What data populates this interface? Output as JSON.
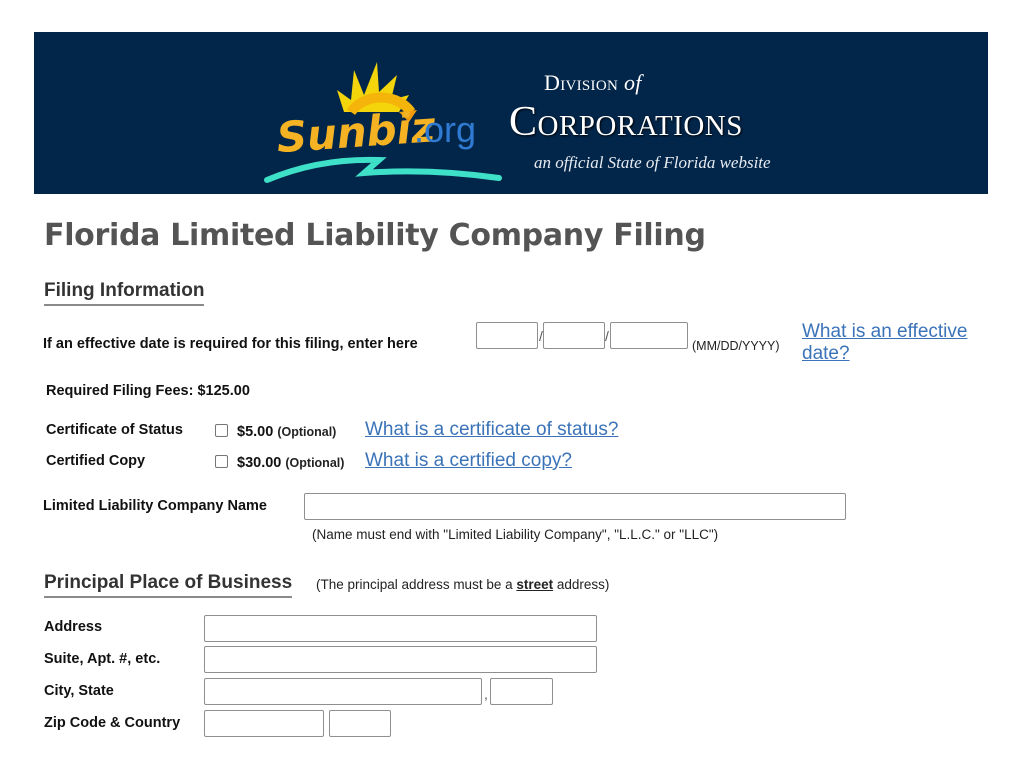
{
  "header": {
    "logo_text": "Sunbiz",
    "logo_domain": ".org",
    "division_prefix": "Division",
    "division_of": "of",
    "division_name": "Corporations",
    "tagline": "an official State of Florida website",
    "background_color": "#02264a"
  },
  "page_title": "Florida Limited Liability Company Filing",
  "filing_information": {
    "section_title": "Filing Information",
    "effective_date": {
      "label": "If an effective date is required for this filing, enter here",
      "month_value": "",
      "day_value": "",
      "year_value": "",
      "separator": "/",
      "format_hint": "(MM/DD/YYYY)",
      "help_link": "What is an effective date?"
    },
    "required_fees_label": "Required Filing Fees: $125.00",
    "options": [
      {
        "label": "Certificate of Status",
        "checked": false,
        "price": "$5.00",
        "optional_tag": "(Optional)",
        "help_link": "What is a certificate of status?"
      },
      {
        "label": "Certified Copy",
        "checked": false,
        "price": "$30.00",
        "optional_tag": "(Optional)",
        "help_link": "What is a certified copy?"
      }
    ],
    "company_name": {
      "label": "Limited Liability Company Name",
      "value": "",
      "note": "(Name must end with \"Limited Liability Company\", \"L.L.C.\" or \"LLC\")"
    }
  },
  "principal_place": {
    "section_title": "Principal Place of Business",
    "note_prefix": "(The principal address must be a",
    "note_emphasis": "street",
    "note_suffix": "address)",
    "fields": {
      "address_label": "Address",
      "address_value": "",
      "suite_label": "Suite, Apt. #, etc.",
      "suite_value": "",
      "city_state_label": "City, State",
      "city_value": "",
      "city_state_separator": ",",
      "state_value": "",
      "zip_country_label": "Zip Code & Country",
      "zip_value": "",
      "country_value": ""
    }
  },
  "colors": {
    "link": "#3b73b9",
    "title": "#545454"
  }
}
